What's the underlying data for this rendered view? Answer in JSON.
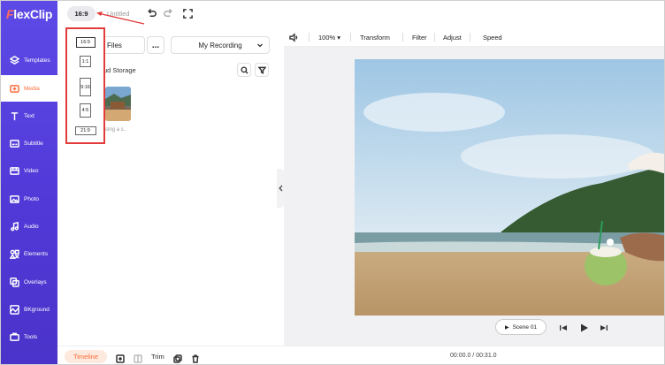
{
  "app": {
    "logo": "FlexClip"
  },
  "topbar": {
    "ratio": "16:9",
    "title": "Untitled"
  },
  "sidebar": {
    "items": [
      {
        "label": "Templates",
        "icon": "templates-icon",
        "active": false
      },
      {
        "label": "Media",
        "icon": "media-icon",
        "active": true
      },
      {
        "label": "Text",
        "icon": "text-icon",
        "active": false
      },
      {
        "label": "Subtitle",
        "icon": "subtitle-icon",
        "active": false
      },
      {
        "label": "Video",
        "icon": "video-icon",
        "active": false
      },
      {
        "label": "Photo",
        "icon": "photo-icon",
        "active": false
      },
      {
        "label": "Audio",
        "icon": "audio-icon",
        "active": false
      },
      {
        "label": "Elements",
        "icon": "elements-icon",
        "active": false
      },
      {
        "label": "Overlays",
        "icon": "overlays-icon",
        "active": false
      },
      {
        "label": "BKground",
        "icon": "bkground-icon",
        "active": false
      },
      {
        "label": "Tools",
        "icon": "tools-icon",
        "active": false
      }
    ]
  },
  "panel": {
    "files_label": "Files",
    "more_label": "...",
    "recording_label": "My Recording",
    "cloud_label": "ud Storage",
    "thumb_caption": "sing a s.."
  },
  "ratio_menu": {
    "options": [
      "16:9",
      "1:1",
      "9:16",
      "4:5",
      "21:9"
    ],
    "selected": "16:9"
  },
  "editor": {
    "zoom": "100%",
    "tools": [
      "Transform",
      "Filter",
      "Adjust",
      "Speed"
    ],
    "scene_label": "Scene 01"
  },
  "bottom": {
    "timeline_label": "Timeline",
    "trim_label": "Trim",
    "time": "00:00.0 / 00:31.0"
  },
  "colors": {
    "sidebar": "#5139d8",
    "accent": "#ff6b3b",
    "highlight": "#e23b3b"
  }
}
